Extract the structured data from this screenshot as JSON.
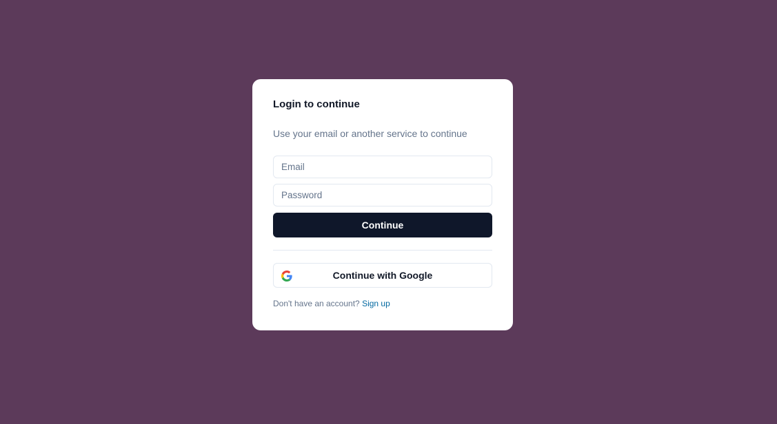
{
  "login": {
    "title": "Login to continue",
    "subtitle": "Use your email or another service to continue",
    "email_placeholder": "Email",
    "password_placeholder": "Password",
    "continue_label": "Continue",
    "google_label": "Continue with Google",
    "google_icon": "google-icon",
    "footer_text": "Don't have an account?",
    "signup_link": "Sign up"
  },
  "colors": {
    "background": "#5c3a5a",
    "card": "#ffffff",
    "primary_button": "#0f172a",
    "link": "#0369a1"
  }
}
